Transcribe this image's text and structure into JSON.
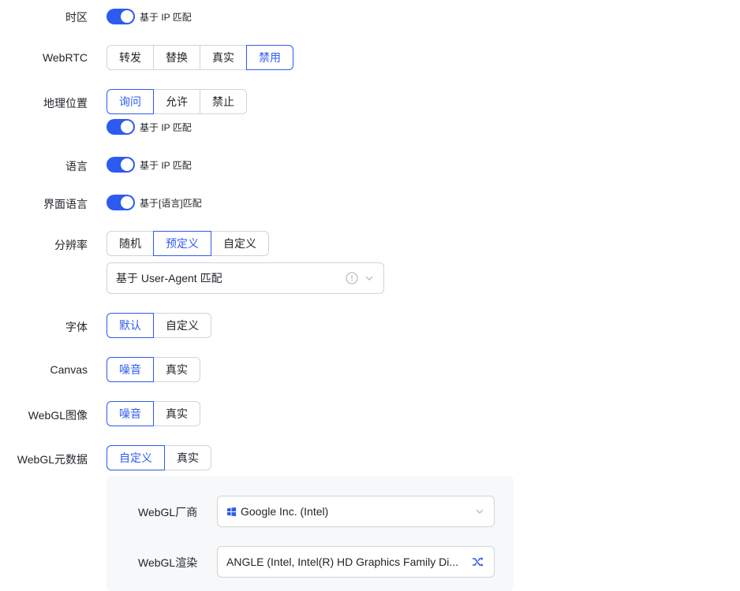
{
  "timezone": {
    "label": "时区",
    "toggle_text": "基于 IP 匹配"
  },
  "webrtc": {
    "label": "WebRTC",
    "options": [
      "转发",
      "替换",
      "真实",
      "禁用"
    ],
    "active": "禁用"
  },
  "geolocation": {
    "label": "地理位置",
    "options": [
      "询问",
      "允许",
      "禁止"
    ],
    "active": "询问",
    "toggle_text": "基于 IP 匹配"
  },
  "language": {
    "label": "语言",
    "toggle_text": "基于 IP 匹配"
  },
  "ui_language": {
    "label": "界面语言",
    "toggle_text": "基于[语言]匹配"
  },
  "resolution": {
    "label": "分辨率",
    "options": [
      "随机",
      "预定义",
      "自定义"
    ],
    "active": "预定义",
    "select_value": "基于 User-Agent 匹配"
  },
  "fonts": {
    "label": "字体",
    "options": [
      "默认",
      "自定义"
    ],
    "active": "默认"
  },
  "canvas": {
    "label": "Canvas",
    "options": [
      "噪音",
      "真实"
    ],
    "active": "噪音"
  },
  "webgl_image": {
    "label": "WebGL图像",
    "options": [
      "噪音",
      "真实"
    ],
    "active": "噪音"
  },
  "webgl_meta": {
    "label": "WebGL元数据",
    "options": [
      "自定义",
      "真实"
    ],
    "active": "自定义",
    "vendor_label": "WebGL厂商",
    "vendor_value": "Google Inc. (Intel)",
    "renderer_label": "WebGL渲染",
    "renderer_value": "ANGLE (Intel, Intel(R) HD Graphics Family Di..."
  },
  "colors": {
    "accent": "#2d5bf0",
    "border": "#d0d3d6",
    "panel_bg": "#f7f8fa"
  }
}
